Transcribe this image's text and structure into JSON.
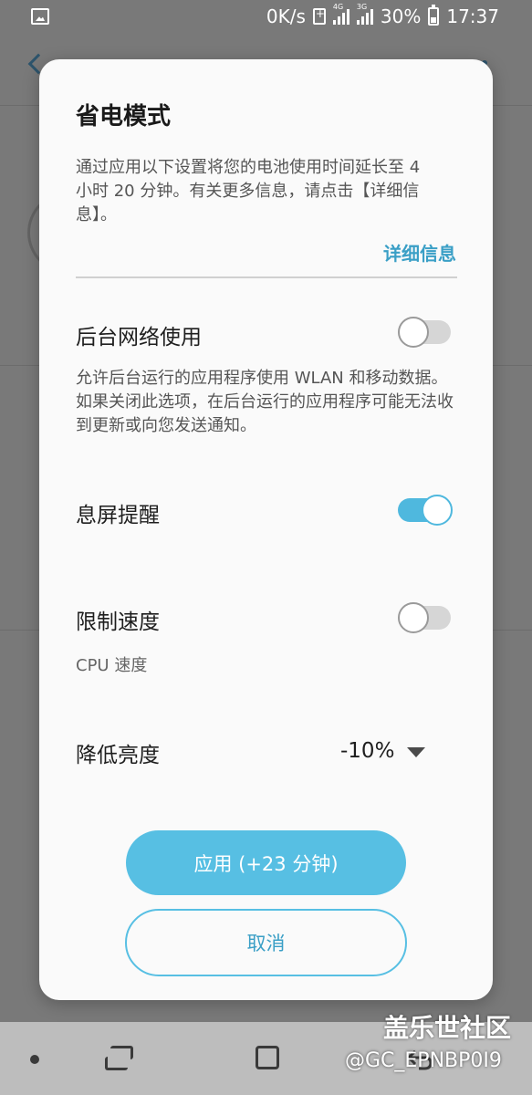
{
  "status_bar": {
    "network_speed": "0K/s",
    "signal_1_tag": "4G",
    "signal_2_tag": "3G",
    "battery_percent": "30%",
    "time": "17:37"
  },
  "dialog": {
    "title": "省电模式",
    "description": "通过应用以下设置将您的电池使用时间延长至 4 小时 20 分钟。有关更多信息，请点击【详细信息】。",
    "details_link": "详细信息",
    "background_network": {
      "label": "后台网络使用",
      "description": "允许后台运行的应用程序使用 WLAN 和移动数据。如果关闭此选项，在后台运行的应用程序可能无法收到更新或向您发送通知。",
      "enabled": false
    },
    "always_on_display": {
      "label": "息屏提醒",
      "enabled": true
    },
    "limit_speed": {
      "label": "限制速度",
      "sub_label": "CPU 速度",
      "enabled": false
    },
    "reduce_brightness": {
      "label": "降低亮度",
      "value": "-10%"
    },
    "apply_button": "应用 (+23 分钟)",
    "cancel_button": "取消"
  },
  "watermark": {
    "main": "盖乐世社区",
    "sub": "@GC_EPNBP0I9"
  },
  "colors": {
    "accent": "#57bfe3",
    "link": "#3a9fc6",
    "dialog_bg": "#fafafa"
  }
}
